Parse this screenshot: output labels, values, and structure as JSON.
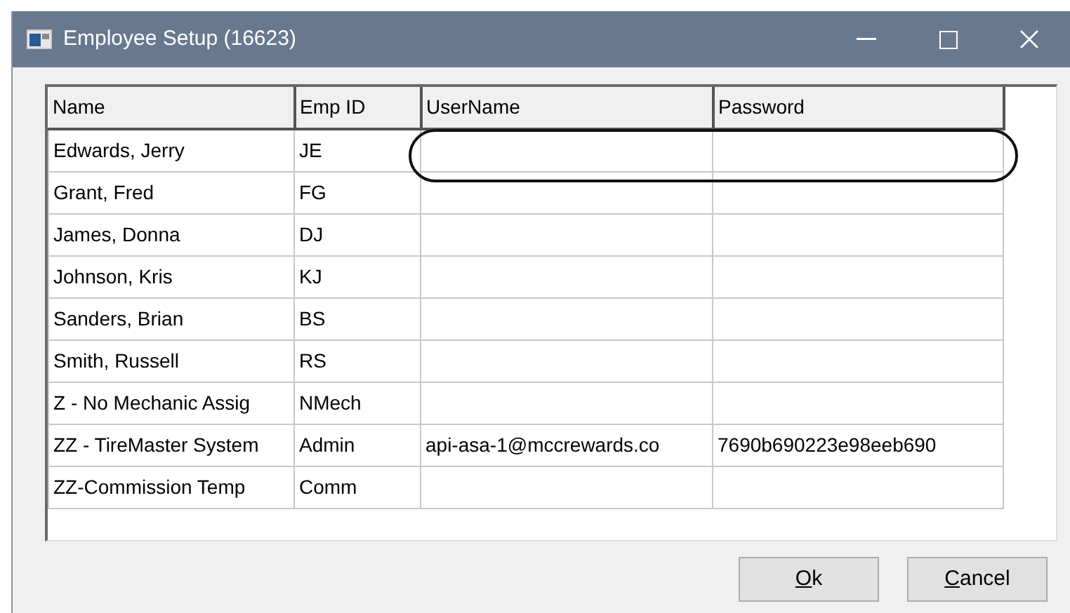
{
  "window": {
    "title": "Employee Setup (16623)"
  },
  "table": {
    "columns": [
      "Name",
      "Emp ID",
      "UserName",
      "Password"
    ],
    "rows": [
      [
        "Edwards, Jerry",
        "JE",
        "",
        ""
      ],
      [
        "Grant, Fred",
        "FG",
        "",
        ""
      ],
      [
        "James, Donna",
        "DJ",
        "",
        ""
      ],
      [
        "Johnson, Kris",
        "KJ",
        "",
        ""
      ],
      [
        "Sanders, Brian",
        "BS",
        "",
        ""
      ],
      [
        "Smith, Russell",
        "RS",
        "",
        ""
      ],
      [
        "Z - No Mechanic Assig",
        "NMech",
        "",
        ""
      ],
      [
        "ZZ - TireMaster System",
        "Admin",
        "api-asa-1@mccrewards.co",
        "7690b690223e98eeb690"
      ],
      [
        "ZZ-Commission Temp",
        "Comm",
        "",
        ""
      ]
    ]
  },
  "buttons": [
    {
      "label": "Ok",
      "mnemonic_underlined": true
    },
    {
      "label": "Cancel",
      "mnemonic_underlined": true
    }
  ]
}
